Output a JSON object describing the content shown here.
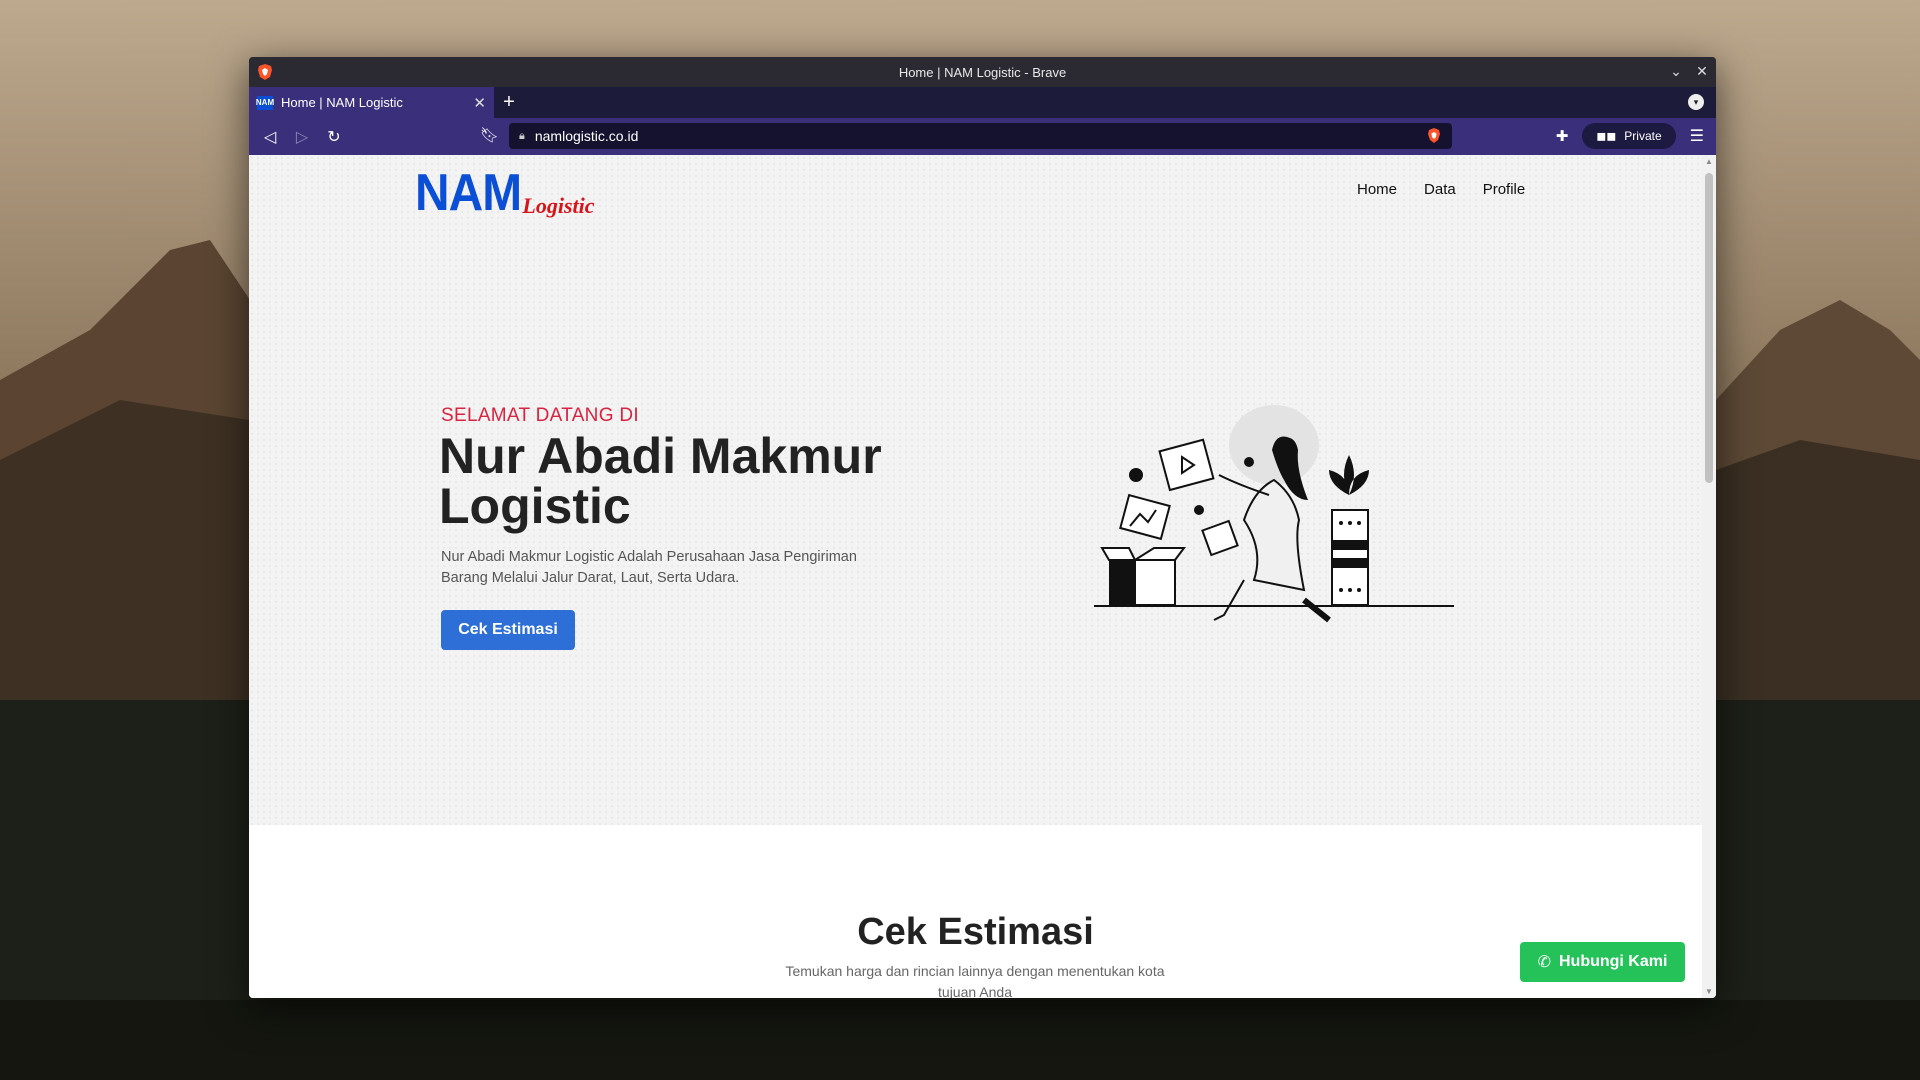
{
  "window": {
    "title": "Home | NAM Logistic - Brave"
  },
  "tabs": [
    {
      "label": "Home | NAM Logistic",
      "favicon": "NAM"
    }
  ],
  "toolbar": {
    "url": "namlogistic.co.id",
    "private_label": "Private"
  },
  "site": {
    "logo_main": "NAM",
    "logo_sub": "Logistic",
    "nav": [
      "Home",
      "Data",
      "Profile"
    ],
    "hero": {
      "kicker": "SELAMAT DATANG DI",
      "title": "Nur Abadi Makmur Logistic",
      "description": "Nur Abadi Makmur Logistic Adalah Perusahaan Jasa Pengiriman Barang Melalui Jalur Darat, Laut, Serta Udara.",
      "cta": "Cek Estimasi"
    },
    "estimasi": {
      "title": "Cek Estimasi",
      "subtitle": "Temukan harga dan rincian lainnya dengan menentukan kota tujuan Anda"
    },
    "whatsapp_button": "Hubungi Kami"
  },
  "colors": {
    "brand_blue": "#0b4fd6",
    "brand_red": "#d7141a",
    "cta_blue": "#2d6fd6",
    "whatsapp_green": "#25c25a",
    "browser_purple": "#3a2f7a"
  }
}
